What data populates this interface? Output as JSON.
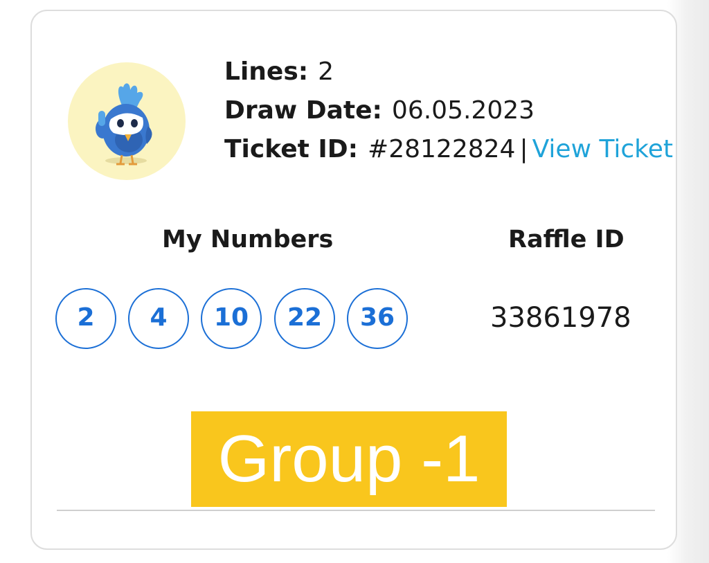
{
  "ticket": {
    "avatar_icon": "mascot-thumbs-up-icon",
    "lines_label": "Lines:",
    "lines_value": "2",
    "draw_date_label": "Draw Date:",
    "draw_date_value": "06.05.2023",
    "ticket_id_label": "Ticket ID:",
    "ticket_id_value": "#28122824",
    "separator": "|",
    "view_ticket_label": "View Ticket"
  },
  "numbers": {
    "heading": "My Numbers",
    "values": [
      "2",
      "4",
      "10",
      "22",
      "36"
    ]
  },
  "raffle": {
    "heading": "Raffle ID",
    "value": "33861978"
  },
  "banner": {
    "text": "Group -1"
  },
  "colors": {
    "accent_blue": "#1b6fd6",
    "link_blue": "#1fa3d9",
    "banner_yellow": "#f9c61d",
    "avatar_bg": "#fbf4c1"
  }
}
